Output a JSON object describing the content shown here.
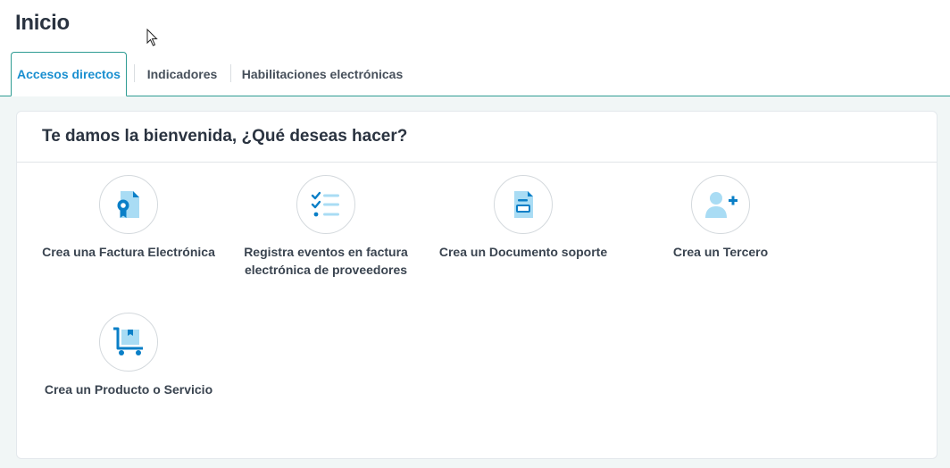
{
  "page": {
    "title": "Inicio"
  },
  "tabs": [
    {
      "label": "Accesos directos",
      "active": true
    },
    {
      "label": "Indicadores",
      "active": false
    },
    {
      "label": "Habilitaciones electrónicas",
      "active": false
    }
  ],
  "card": {
    "title": "Te damos la bienvenida, ¿Qué deseas hacer?"
  },
  "shortcuts": [
    {
      "label": "Crea una Factura Electrónica",
      "icon": "invoice-ribbon-icon"
    },
    {
      "label": "Registra eventos en factura electrónica de proveedores",
      "icon": "checklist-icon"
    },
    {
      "label": "Crea un Documento soporte",
      "icon": "document-icon"
    },
    {
      "label": "Crea un Tercero",
      "icon": "add-user-icon"
    },
    {
      "label": "Crea un Producto o Servicio",
      "icon": "cart-box-icon"
    }
  ],
  "colors": {
    "accent": "#1a8fd0",
    "icon_light": "#a9dcf4",
    "icon_dark": "#0a7fc7",
    "tab_border": "#2f9c93"
  }
}
